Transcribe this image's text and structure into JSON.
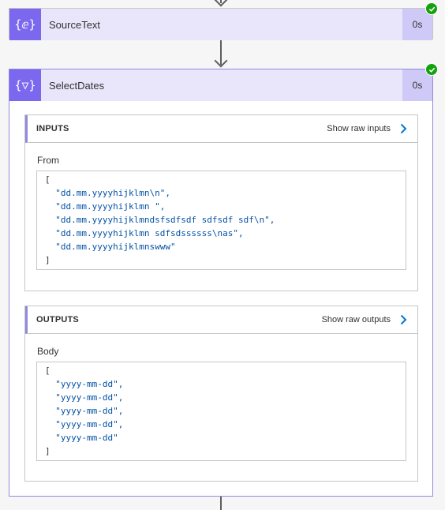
{
  "flow": {
    "actions": [
      {
        "title": "SourceText",
        "duration": "0s",
        "icon": "{ⅇ}",
        "status": "succeeded"
      },
      {
        "title": "SelectDates",
        "duration": "0s",
        "icon": "{▽}",
        "status": "succeeded"
      }
    ]
  },
  "select_dates": {
    "inputs": {
      "title": "INPUTS",
      "raw_link": "Show raw inputs",
      "field_label": "From",
      "open_bracket": "[",
      "close_bracket": "]",
      "lines": [
        "\"dd.mm.yyyyhijklmn\\n\",",
        "\"dd.mm.yyyyhijklmn \",",
        "\"dd.mm.yyyyhijklmndsfsdfsdf sdfsdf sdf\\n\",",
        "\"dd.mm.yyyyhijklmn sdfsdssssss\\nas\",",
        "\"dd.mm.yyyyhijklmnswww\""
      ]
    },
    "outputs": {
      "title": "OUTPUTS",
      "raw_link": "Show raw outputs",
      "field_label": "Body",
      "open_bracket": "[",
      "close_bracket": "]",
      "lines": [
        "\"yyyy-mm-dd\",",
        "\"yyyy-mm-dd\",",
        "\"yyyy-mm-dd\",",
        "\"yyyy-mm-dd\",",
        "\"yyyy-mm-dd\""
      ]
    }
  },
  "colors": {
    "accent": "#7b68ee",
    "header_bg": "#e9e6fb",
    "success": "#13a10e",
    "code_text": "#0451a5"
  }
}
